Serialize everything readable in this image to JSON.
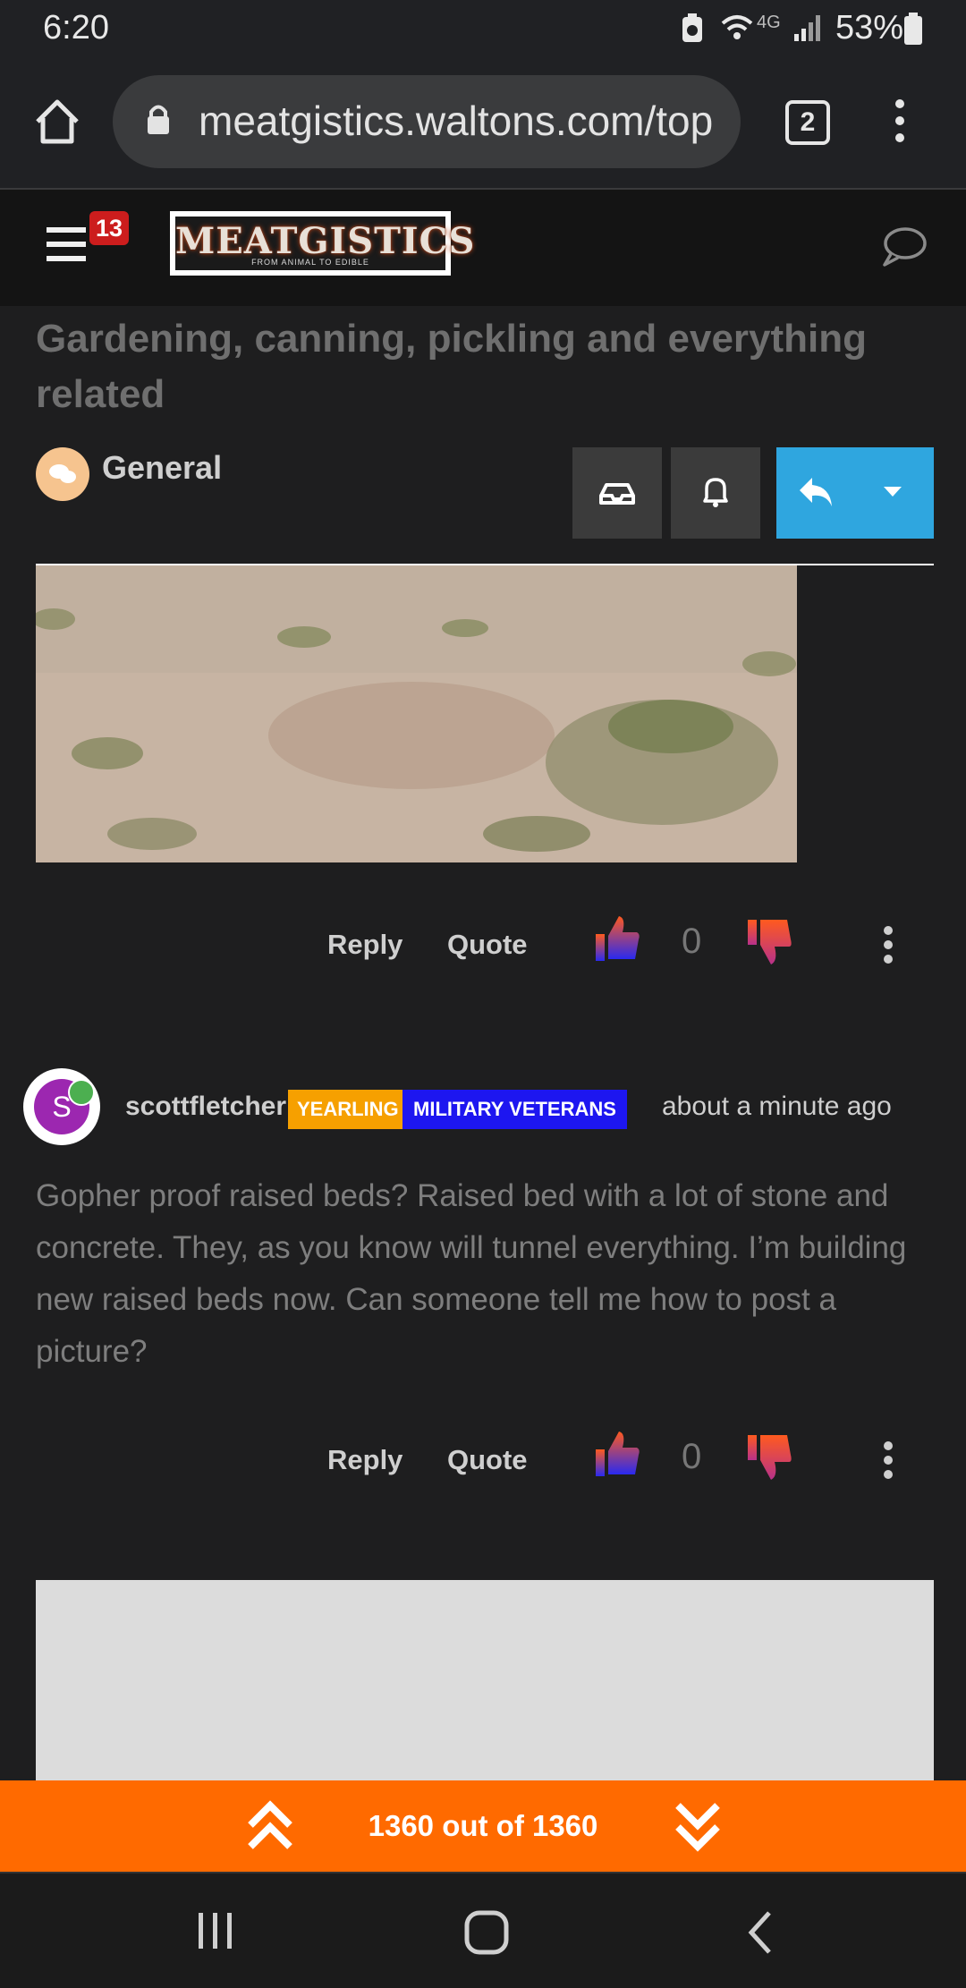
{
  "status": {
    "time": "6:20",
    "network": "4G",
    "battery": "53%"
  },
  "browser": {
    "url": "meatgistics.waltons.com/top",
    "tab_count": "2"
  },
  "header": {
    "notification_count": "13",
    "logo_text": "MEATGISTICS",
    "logo_tagline": "FROM ANIMAL TO EDIBLE"
  },
  "topic": {
    "title": "Gardening, canning, pickling and everything related",
    "category": "General"
  },
  "post_actions": {
    "reply": "Reply",
    "quote": "Quote",
    "vote_count_1": "0",
    "vote_count_2": "0"
  },
  "post": {
    "avatar_letter": "S",
    "username": "scottfletcher",
    "badge_1": "YEARLING",
    "badge_2": "MILITARY VETERANS",
    "time": "about a minute ago",
    "body": "Gopher proof raised beds? Raised bed with a lot of stone and concrete. They, as you know will tunnel everything. I’m building new raised beds now. Can someone tell me how to post a picture?"
  },
  "pager": {
    "label": "1360 out of 1360"
  },
  "colors": {
    "accent_blue": "#2fa6df",
    "accent_orange": "#ff6a00",
    "yearling": "#f6a000",
    "military": "#1d16f0"
  }
}
